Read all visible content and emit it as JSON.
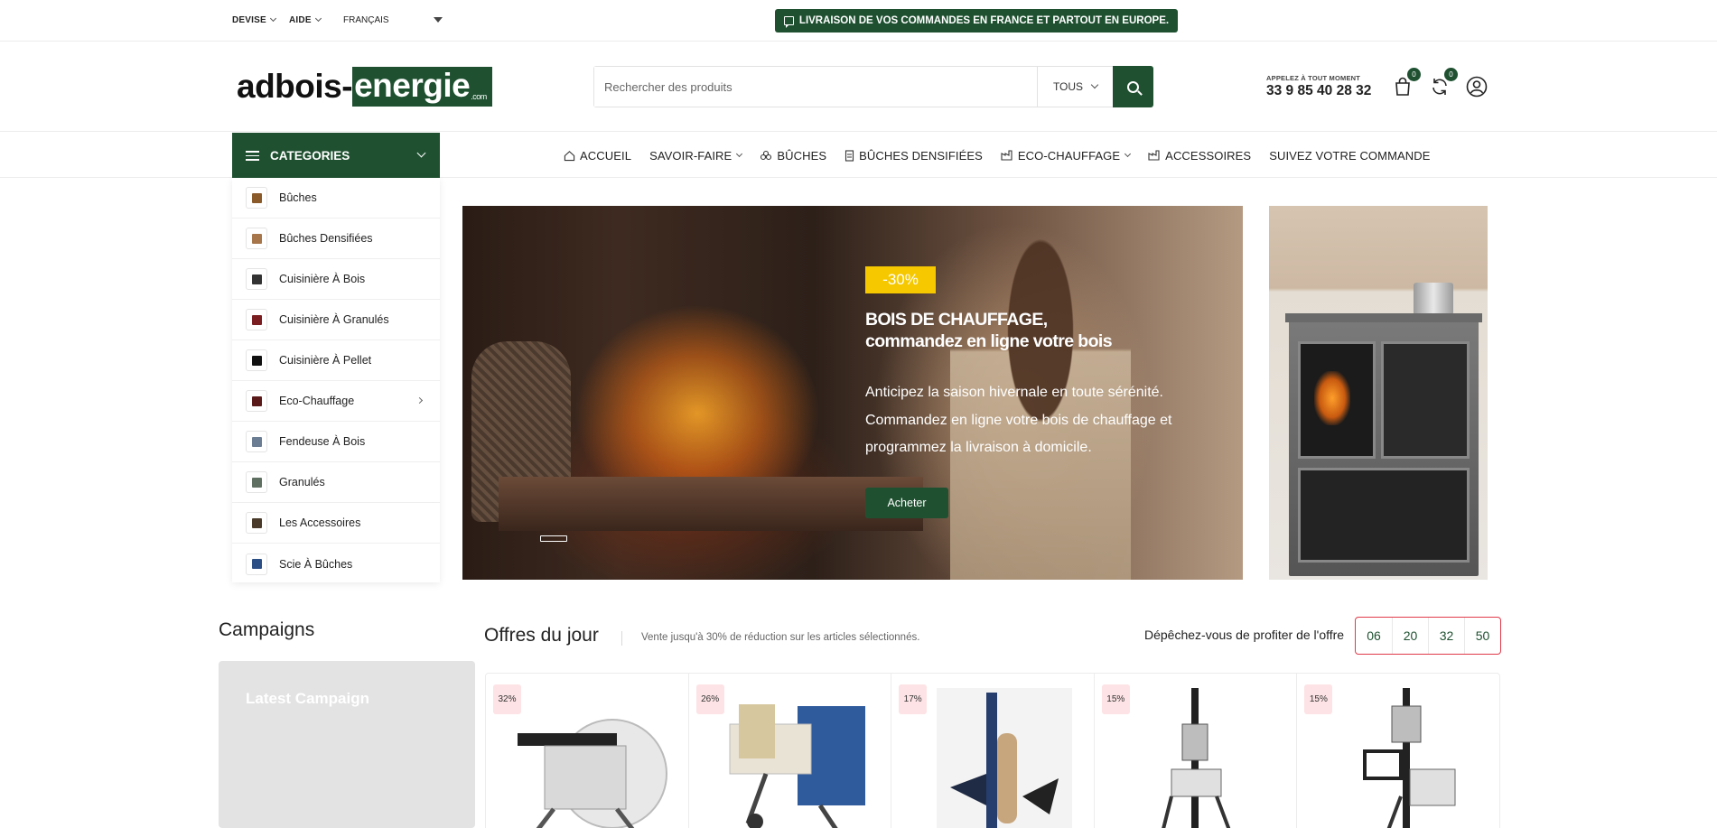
{
  "topbar": {
    "currency": "DEVISE",
    "help": "AIDE",
    "language": "FRANÇAIS",
    "shipping": "LIVRAISON DE VOS COMMANDES EN FRANCE ET PARTOUT EN EUROPE."
  },
  "header": {
    "logo_left": "adbois-",
    "logo_right": "energie",
    "logo_tld": ".com",
    "search_placeholder": "Rechercher des produits",
    "search_category": "TOUS",
    "phone_label": "APPELEZ À TOUT MOMENT",
    "phone_number": "33 9 85 40 28 32",
    "cart_count": "0",
    "compare_count": "0"
  },
  "nav": {
    "categories_label": "CATEGORIES",
    "links": [
      {
        "label": "ACCUEIL"
      },
      {
        "label": "SAVOIR-FAIRE"
      },
      {
        "label": "BÛCHES"
      },
      {
        "label": "BÛCHES DENSIFIÉES"
      },
      {
        "label": "ECO-CHAUFFAGE"
      },
      {
        "label": "ACCESSOIRES"
      },
      {
        "label": "SUIVEZ VOTRE COMMANDE"
      }
    ]
  },
  "categories": [
    {
      "label": "Bûches",
      "color": "#8a5a2b"
    },
    {
      "label": "Bûches Densifiées",
      "color": "#a7764a"
    },
    {
      "label": "Cuisinière À Bois",
      "color": "#333333"
    },
    {
      "label": "Cuisinière À Granulés",
      "color": "#7a1e22"
    },
    {
      "label": "Cuisinière À Pellet",
      "color": "#111111"
    },
    {
      "label": "Eco-Chauffage",
      "color": "#5a1a1a"
    },
    {
      "label": "Fendeuse À Bois",
      "color": "#6a7d93"
    },
    {
      "label": "Granulés",
      "color": "#5f6f62"
    },
    {
      "label": "Les Accessoires",
      "color": "#4a3a2a"
    },
    {
      "label": "Scie À Bûches",
      "color": "#2c4f86"
    }
  ],
  "hero": {
    "badge": "-30%",
    "title_line1": "BOIS DE CHAUFFAGE,",
    "title_line2": "commandez en ligne votre bois",
    "text": "Anticipez la saison hivernale en toute sérénité. Commandez en ligne votre bois de chauffage et programmez la livraison à domicile.",
    "button": "Acheter"
  },
  "campaigns": {
    "title": "Campaigns",
    "card_label": "Latest Campaign"
  },
  "deals": {
    "title": "Offres du jour",
    "subtitle": "Vente jusqu'à 30% de réduction sur les articles sélectionnés.",
    "countdown_label": "Dépêchez-vous de profiter de l'offre",
    "countdown": [
      "06",
      "20",
      "32",
      "50"
    ],
    "products": [
      {
        "discount": "32%"
      },
      {
        "discount": "26%"
      },
      {
        "discount": "17%"
      },
      {
        "discount": "15%"
      },
      {
        "discount": "15%"
      }
    ]
  }
}
